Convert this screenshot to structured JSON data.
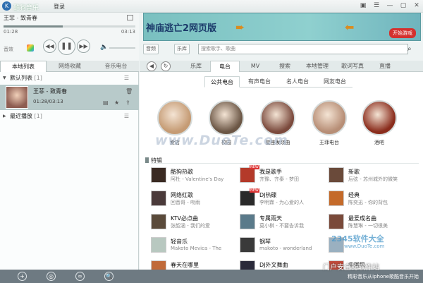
{
  "titlebar": {
    "app_name": "酷狗音乐",
    "login": "登录",
    "buttons": [
      "▣",
      "☰",
      "—",
      "▢",
      "✕"
    ]
  },
  "player": {
    "artist": "王菲",
    "separator": " - ",
    "song": "致青春",
    "time_current": "01:28",
    "time_total": "03:13",
    "progress": 0.45,
    "ctl_label": "音效",
    "prev": "◀◀",
    "play": "❚❚",
    "next": "▶▶",
    "volume_icon": "🔈"
  },
  "banner": {
    "title": "神庙逃亡2网页版",
    "cta": "开始游戏"
  },
  "toolbar": {
    "btn_a": "音频",
    "btn_b": "乐库",
    "search_placeholder": "搜索歌手、歌曲"
  },
  "left_tabs": [
    {
      "label": "本地列表"
    },
    {
      "label": "网络收藏"
    },
    {
      "label": "音乐电台"
    }
  ],
  "lists": {
    "default": {
      "name": "默认列表",
      "count": "[1]"
    },
    "recent": {
      "name": "最近播放",
      "count": "[1]"
    }
  },
  "now_playing": {
    "title": "王菲 - 致青春",
    "time": "01:28/03:13"
  },
  "nav": {
    "back": "◀",
    "refresh": "↻",
    "items": [
      {
        "label": "乐库"
      },
      {
        "label": "电台"
      },
      {
        "label": "MV"
      },
      {
        "label": "搜索"
      },
      {
        "label": "本地管理"
      },
      {
        "label": "歌词写真"
      },
      {
        "label": "直播"
      }
    ]
  },
  "subtabs": [
    {
      "label": "公共电台"
    },
    {
      "label": "有声电台"
    },
    {
      "label": "名人电台"
    },
    {
      "label": "网友电台"
    }
  ],
  "stations": [
    {
      "label": "爱店",
      "color": "#c59b74"
    },
    {
      "label": "校园",
      "color": "#6b5645"
    },
    {
      "label": "星座发烧曲",
      "color": "#7b4a3d"
    },
    {
      "label": "王菲电台",
      "color": "#b78e76"
    },
    {
      "label": "酒吧",
      "color": "#8a2c1c"
    }
  ],
  "watermark": "www.DuoTe.com",
  "section_title": "特辑",
  "featured": [
    {
      "title": "酷狗热歌",
      "desc": "阿杜 - Valentine's Day",
      "color": "#3a2a22",
      "new": false
    },
    {
      "title": "我是歌手",
      "desc": "齐豫、齐秦 - 梦田",
      "color": "#b43a2a",
      "new": true
    },
    {
      "title": "新歌",
      "desc": "后弦 - 苏州城外的微笑",
      "color": "#6a4a3a",
      "new": false
    },
    {
      "title": "网络红歌",
      "desc": "回音哥 - 吻雨",
      "color": "#4a3a3a",
      "new": false
    },
    {
      "title": "DJ热碟",
      "desc": "李明霖 - 为心爱的人",
      "color": "#2a2a2a",
      "new": true
    },
    {
      "title": "经典",
      "desc": "陈奕迅 - 你的背包",
      "color": "#c46a2a",
      "new": false
    },
    {
      "title": "KTV必点曲",
      "desc": "张韶涵 - 我们的爱",
      "color": "#5a4a3a",
      "new": false
    },
    {
      "title": "专属雨天",
      "desc": "莫小棋 - 不要告诉我",
      "color": "#5a7a8a",
      "new": false
    },
    {
      "title": "最爱成名曲",
      "desc": "陈慧琳 - 一切很美",
      "color": "#7a4a3a",
      "new": false
    },
    {
      "title": "轻音乐",
      "desc": "Makoto Mevica - The",
      "color": "#b8c8c0",
      "new": false
    },
    {
      "title": "钢琴",
      "desc": "makoto - wonderland",
      "color": "#3a3a3a",
      "new": false
    },
    {
      "title": "",
      "desc": "",
      "color": "#9ab0c0",
      "new": false
    },
    {
      "title": "春天在哪里",
      "desc": "",
      "color": "#c06a3a",
      "new": false
    },
    {
      "title": "DJ外文舞曲",
      "desc": "",
      "color": "#2a2a3a",
      "new": false
    },
    {
      "title": "中国风",
      "desc": "",
      "color": "#c04a3a",
      "new": false
    }
  ],
  "corner_watermark": {
    "big": "2345软件大全",
    "url": "www.DuoTe.com"
  },
  "bottombar": {
    "buttons": [
      "+",
      "◎",
      "∞",
      "🔍"
    ],
    "overlay": "门户安全的软件站",
    "text": "精彩音乐从iphone歌酷音乐开始"
  }
}
